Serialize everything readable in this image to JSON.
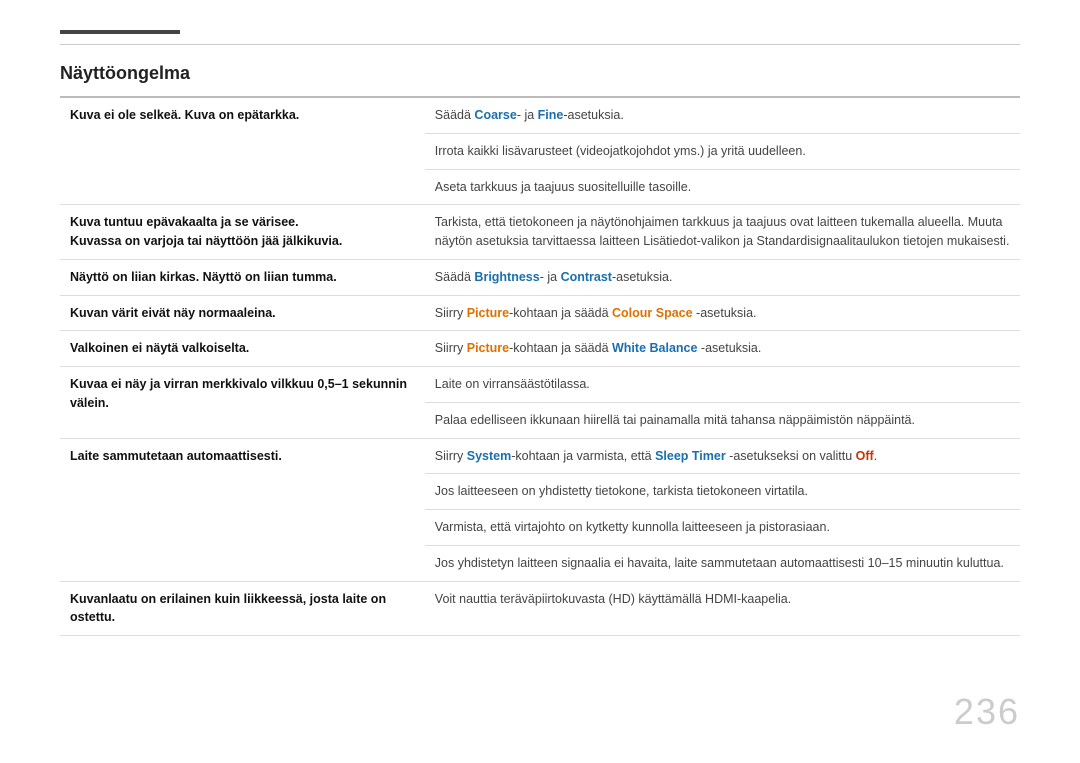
{
  "page": {
    "title": "Näyttöongelma",
    "page_number": "236"
  },
  "top_accent": "",
  "rows": [
    {
      "id": "row1",
      "problem": "Kuva ei ole selkeä. Kuva on epätarkka.",
      "solutions": [
        {
          "text_parts": [
            {
              "text": "Säädä ",
              "style": "normal"
            },
            {
              "text": "Coarse",
              "style": "blue"
            },
            {
              "text": "- ja ",
              "style": "normal"
            },
            {
              "text": "Fine",
              "style": "blue"
            },
            {
              "text": "-asetuksia.",
              "style": "normal"
            }
          ]
        },
        {
          "text": "Irrota kaikki lisävarusteet (videojatkojohdot yms.) ja yritä uudelleen."
        },
        {
          "text": "Aseta tarkkuus ja taajuus suositelluille tasoille."
        }
      ]
    },
    {
      "id": "row2",
      "problem": "Kuva tuntuu epävakaalta ja se värisee.\nKuvassa on varjoja tai näyttöön jää jälkikuvia.",
      "solutions": [
        {
          "text": "Tarkista, että tietokoneen ja näytönohjaimen tarkkuus ja taajuus ovat laitteen tukemalla alueella. Muuta näytön asetuksia tarvittaessa laitteen Lisätiedot-valikon ja Standardisignaalitaulukon tietojen mukaisesti."
        }
      ]
    },
    {
      "id": "row3",
      "problem": "Näyttö on liian kirkas. Näyttö on liian tumma.",
      "solutions": [
        {
          "text_parts": [
            {
              "text": "Säädä ",
              "style": "normal"
            },
            {
              "text": "Brightness",
              "style": "blue"
            },
            {
              "text": "- ja ",
              "style": "normal"
            },
            {
              "text": "Contrast",
              "style": "blue"
            },
            {
              "text": "-asetuksia.",
              "style": "normal"
            }
          ]
        }
      ]
    },
    {
      "id": "row4",
      "problem": "Kuvan värit eivät näy normaaleina.",
      "solutions": [
        {
          "text_parts": [
            {
              "text": "Siirry ",
              "style": "normal"
            },
            {
              "text": "Picture",
              "style": "orange"
            },
            {
              "text": "-kohtaan ja säädä ",
              "style": "normal"
            },
            {
              "text": "Colour Space",
              "style": "orange"
            },
            {
              "text": " -asetuksia.",
              "style": "normal"
            }
          ]
        }
      ]
    },
    {
      "id": "row5",
      "problem": "Valkoinen ei näytä valkoiselta.",
      "solutions": [
        {
          "text_parts": [
            {
              "text": "Siirry ",
              "style": "normal"
            },
            {
              "text": "Picture",
              "style": "orange"
            },
            {
              "text": "-kohtaan ja säädä ",
              "style": "normal"
            },
            {
              "text": "White Balance",
              "style": "blue"
            },
            {
              "text": " -asetuksia.",
              "style": "normal"
            }
          ]
        }
      ]
    },
    {
      "id": "row6",
      "problem": "Kuvaa ei näy ja virran merkkivalo vilkkuu 0,5–1 sekunnin välein.",
      "solutions": [
        {
          "text": "Laite on virransäästötilassa."
        },
        {
          "text": "Palaa edelliseen ikkunaan hiirellä tai painamalla mitä tahansa näppäimistön näppäintä."
        }
      ]
    },
    {
      "id": "row7",
      "problem": "Laite sammutetaan automaattisesti.",
      "solutions": [
        {
          "text_parts": [
            {
              "text": "Siirry ",
              "style": "normal"
            },
            {
              "text": "System",
              "style": "blue"
            },
            {
              "text": "-kohtaan ja varmista, että ",
              "style": "normal"
            },
            {
              "text": "Sleep Timer",
              "style": "blue"
            },
            {
              "text": " -asetukseksi on valittu ",
              "style": "normal"
            },
            {
              "text": "Off",
              "style": "red"
            },
            {
              "text": ".",
              "style": "normal"
            }
          ]
        },
        {
          "text": "Jos laitteeseen on yhdistetty tietokone, tarkista tietokoneen virtatila."
        },
        {
          "text": "Varmista, että virtajohto on kytketty kunnolla laitteeseen ja pistorasiaan."
        },
        {
          "text": "Jos yhdistetyn laitteen signaalia ei havaita, laite sammutetaan automaattisesti 10–15 minuutin kuluttua."
        }
      ]
    },
    {
      "id": "row8",
      "problem": "Kuvanlaatu on erilainen kuin liikkeessä, josta laite on ostettu.",
      "solutions": [
        {
          "text": "Voit nauttia teräväpiirtokuvasta (HD) käyttämällä HDMI-kaapelia."
        }
      ]
    }
  ]
}
